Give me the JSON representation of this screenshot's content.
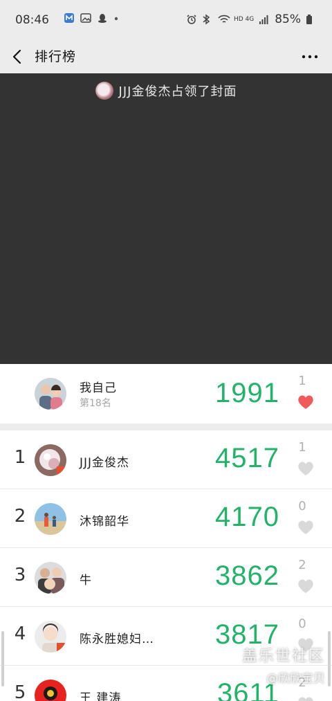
{
  "status_bar": {
    "time": "08:46",
    "battery": "85%",
    "network": "HD 4G"
  },
  "nav": {
    "title": "排行榜"
  },
  "cover": {
    "caption": "JJJ金俊杰占领了封面"
  },
  "me": {
    "name": "我自己",
    "rank_text": "第18名",
    "steps": "1991",
    "likes": "1",
    "liked": true
  },
  "ranking": [
    {
      "rank": "1",
      "name": "JJJ金俊杰",
      "steps": "4517",
      "likes": "1"
    },
    {
      "rank": "2",
      "name": "沐锦韶华",
      "steps": "4170",
      "likes": "0"
    },
    {
      "rank": "3",
      "name": "牛",
      "steps": "3862",
      "likes": "2"
    },
    {
      "rank": "4",
      "name": "陈永胜媳妇…",
      "steps": "3817",
      "likes": "0"
    },
    {
      "rank": "5",
      "name": "王 建涛",
      "steps": "3611",
      "likes": "2"
    }
  ],
  "watermark": {
    "line1": "盖乐世社区",
    "line2": "@欣欣宝贝"
  },
  "colors": {
    "steps_green": "#21b368",
    "heart_red": "#f05a5a",
    "heart_gray": "#d9d9d9",
    "cover_bg": "#333333"
  }
}
